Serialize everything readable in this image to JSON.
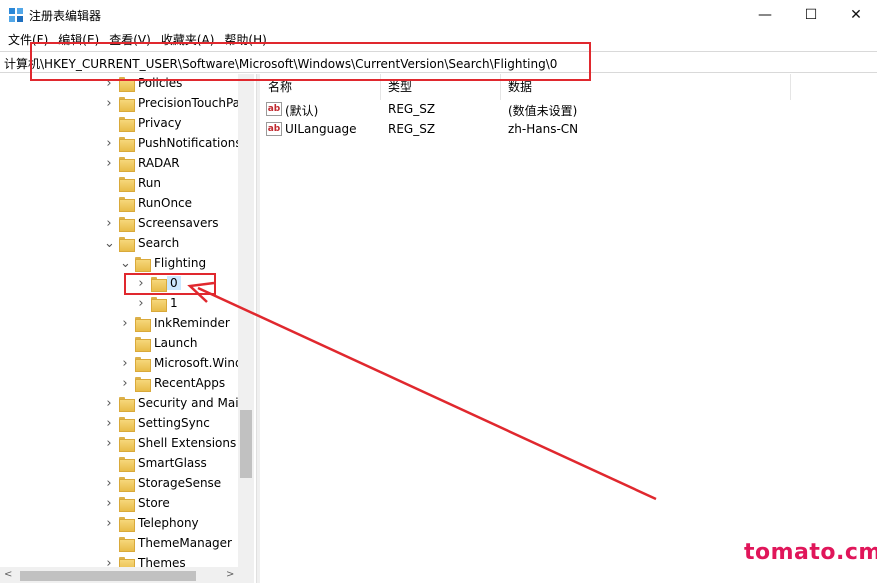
{
  "window": {
    "title": "注册表编辑器",
    "icon": "regedit-icon"
  },
  "controls": {
    "minimize": "—",
    "maximize": "☐",
    "close": "✕"
  },
  "menu": [
    {
      "id": "file",
      "label": "文件(F)"
    },
    {
      "id": "edit",
      "label": "编辑(E)"
    },
    {
      "id": "view",
      "label": "查看(V)"
    },
    {
      "id": "favorites",
      "label": "收藏夹(A)"
    },
    {
      "id": "help",
      "label": "帮助(H)"
    }
  ],
  "address": {
    "path": "计算机\\HKEY_CURRENT_USER\\Software\\Microsoft\\Windows\\CurrentVersion\\Search\\Flighting\\0"
  },
  "tree": [
    {
      "label": "Policies",
      "depth": 0,
      "expander": "collapsed"
    },
    {
      "label": "PrecisionTouchPad",
      "depth": 0,
      "expander": "collapsed"
    },
    {
      "label": "Privacy",
      "depth": 0,
      "expander": "none"
    },
    {
      "label": "PushNotifications",
      "depth": 0,
      "expander": "collapsed"
    },
    {
      "label": "RADAR",
      "depth": 0,
      "expander": "collapsed"
    },
    {
      "label": "Run",
      "depth": 0,
      "expander": "none"
    },
    {
      "label": "RunOnce",
      "depth": 0,
      "expander": "none"
    },
    {
      "label": "Screensavers",
      "depth": 0,
      "expander": "collapsed"
    },
    {
      "label": "Search",
      "depth": 0,
      "expander": "expanded"
    },
    {
      "label": "Flighting",
      "depth": 1,
      "expander": "expanded"
    },
    {
      "label": "0",
      "depth": 2,
      "expander": "collapsed",
      "selected": true
    },
    {
      "label": "1",
      "depth": 2,
      "expander": "collapsed"
    },
    {
      "label": "InkReminder",
      "depth": 1,
      "expander": "collapsed"
    },
    {
      "label": "Launch",
      "depth": 1,
      "expander": "none"
    },
    {
      "label": "Microsoft.Windows",
      "depth": 1,
      "expander": "collapsed"
    },
    {
      "label": "RecentApps",
      "depth": 1,
      "expander": "collapsed"
    },
    {
      "label": "Security and Maintenance",
      "depth": 0,
      "expander": "collapsed"
    },
    {
      "label": "SettingSync",
      "depth": 0,
      "expander": "collapsed"
    },
    {
      "label": "Shell Extensions",
      "depth": 0,
      "expander": "collapsed"
    },
    {
      "label": "SmartGlass",
      "depth": 0,
      "expander": "none"
    },
    {
      "label": "StorageSense",
      "depth": 0,
      "expander": "collapsed"
    },
    {
      "label": "Store",
      "depth": 0,
      "expander": "collapsed"
    },
    {
      "label": "Telephony",
      "depth": 0,
      "expander": "collapsed"
    },
    {
      "label": "ThemeManager",
      "depth": 0,
      "expander": "none"
    },
    {
      "label": "Themes",
      "depth": 0,
      "expander": "collapsed"
    }
  ],
  "values_pane": {
    "columns": [
      "名称",
      "类型",
      "数据"
    ],
    "rows": [
      {
        "name": "(默认)",
        "type": "REG_SZ",
        "data": "(数值未设置)",
        "icon": "string-value-icon"
      },
      {
        "name": "UILanguage",
        "type": "REG_SZ",
        "data": "zh-Hans-CN",
        "icon": "string-value-icon"
      }
    ]
  },
  "value_icon_text": "ab",
  "watermark": "tomato.cm",
  "colors": {
    "annotation": "#e0282e",
    "watermark": "#e0165a",
    "selection": "#cce8ff",
    "folder": "#f0c95e"
  }
}
